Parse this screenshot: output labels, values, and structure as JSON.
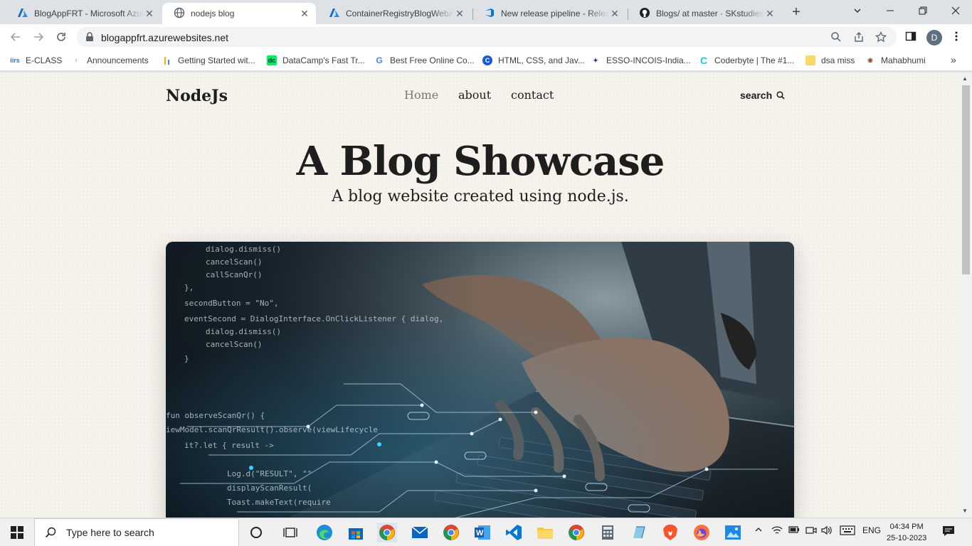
{
  "browser": {
    "tabs": [
      {
        "title": "BlogAppFRT - Microsoft Azure",
        "icon": "azure-icon",
        "active": false
      },
      {
        "title": "nodejs blog",
        "icon": "globe-icon",
        "active": true
      },
      {
        "title": "ContainerRegistryBlogWebApp",
        "icon": "azure-icon",
        "active": false
      },
      {
        "title": "New release pipeline - Releases",
        "icon": "azure-devops-icon",
        "active": false
      },
      {
        "title": "Blogs/ at master · SKstudies",
        "icon": "github-icon",
        "active": false
      }
    ],
    "new_tab": "+",
    "url": "blogappfrt.azurewebsites.net",
    "profile_initial": "D",
    "bookmarks": [
      {
        "label": "E-CLASS",
        "icon": "iirs-icon"
      },
      {
        "label": "Announcements",
        "icon": "announcement-icon"
      },
      {
        "label": "Getting Started wit...",
        "icon": "chart-icon"
      },
      {
        "label": "DataCamp's Fast Tr...",
        "icon": "datacamp-icon"
      },
      {
        "label": "Best Free Online Co...",
        "icon": "g-icon"
      },
      {
        "label": "HTML, CSS, and Jav...",
        "icon": "c-circle-icon"
      },
      {
        "label": "ESSO-INCOIS-India...",
        "icon": "incois-icon"
      },
      {
        "label": "Coderbyte | The #1...",
        "icon": "coderbyte-icon"
      },
      {
        "label": "dsa miss",
        "icon": "folder-icon"
      },
      {
        "label": "Mahabhumi",
        "icon": "mahabhumi-icon"
      }
    ],
    "bookmarks_more": "»"
  },
  "page": {
    "logo": "NodeJs",
    "nav": [
      {
        "label": "Home",
        "current": true
      },
      {
        "label": "about",
        "current": false
      },
      {
        "label": "contact",
        "current": false
      }
    ],
    "search_label": "search",
    "hero_title": "A Blog Showcase",
    "hero_subtitle": "A blog website created using node.js.",
    "hero_code_lines": [
      "dialog.dismiss()",
      "cancelScan()",
      "callScanQr()",
      "},",
      "secondButton = \"No\",",
      "eventSecond = DialogInterface.OnClickListener { dialog,",
      "dialog.dismiss()",
      "cancelScan()",
      "}",
      "fun observeScanQr() {",
      "iewModel.scanQrResult().observe(viewLifecycle",
      "it?.let { result ->",
      "Log.d(\"RESULT\", \"\"",
      "displayScanResult(",
      "Toast.makeText(require"
    ]
  },
  "taskbar": {
    "search_placeholder": "Type here to search",
    "language": "ENG",
    "time": "04:34 PM",
    "date": "25-10-2023"
  },
  "colors": {
    "page_bg": "#f6f2ec",
    "text": "#1e1e1e",
    "nav_current": "#777777"
  }
}
